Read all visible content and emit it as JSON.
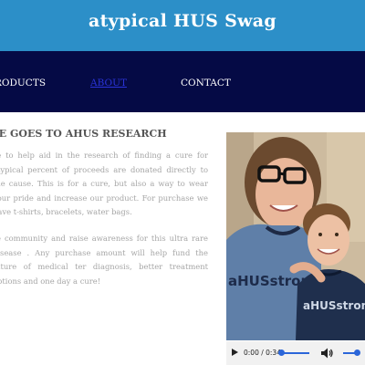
{
  "header": {
    "site_title": "atypical HUS Swag",
    "background": "#2c8fc8"
  },
  "nav": {
    "background": "#050a45",
    "items": [
      {
        "label": "PRODUCTS",
        "visible_text": "RODUCTS",
        "active": false
      },
      {
        "label": "ABOUT",
        "visible_text": "ABOUT",
        "active": true
      },
      {
        "label": "CONTACT",
        "visible_text": "CONTACT",
        "active": false
      }
    ],
    "active_color": "#2a33d8"
  },
  "main": {
    "heading": "CE GOES TO AHUS RESEARCH",
    "paragraphs": [
      "se to help aid in the research of finding a cure for atypical percent of proceeds are donated directly to the cause. This is for a cure, but also a way to wear your pride and increase our product. For purchase we have t-shirts, bracelets, water bags.",
      "re community and raise awareness for this ultra rare disease . Any purchase amount will help fund the future of medical ter diagnosis, better treatment options and one day a cure!"
    ]
  },
  "photo": {
    "shirt_text_left": "aHUSstrong",
    "shirt_text_right": "aHUSstrong"
  },
  "audio": {
    "current_time": "0:00",
    "duration": "0:34",
    "time_display": "0:00 / 0:34",
    "progress": 0.0,
    "volume": 1.0,
    "accent": "#2b66d9"
  }
}
